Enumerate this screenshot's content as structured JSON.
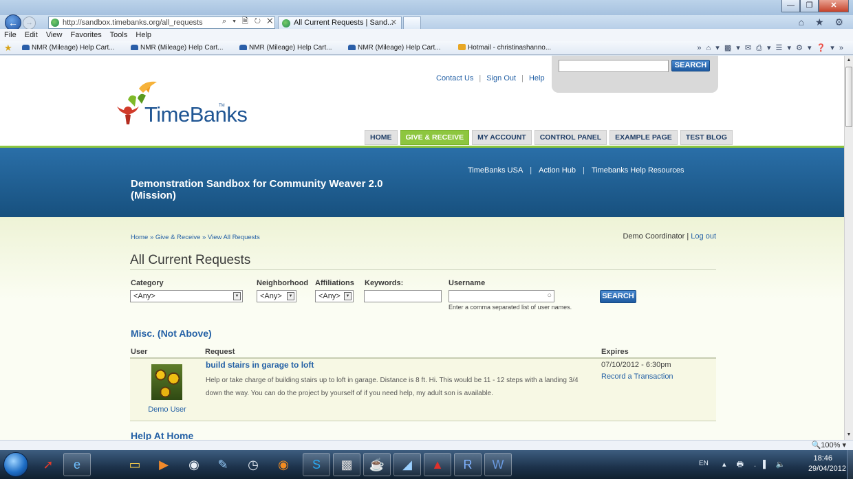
{
  "browser": {
    "address": "http://sandbox.timebanks.org/all_requests",
    "addr_tools": "⌕ ▾ 🗎 ↻ ✕",
    "tab_title": "All Current Requests | Sand...",
    "tab_close": "✕",
    "icons": "⌂ ★ ⚙",
    "menu": [
      "File",
      "Edit",
      "View",
      "Favorites",
      "Tools",
      "Help"
    ],
    "favorites": [
      "NMR (Mileage) Help Cart...",
      "NMR (Mileage) Help Cart...",
      "NMR (Mileage) Help Cart...",
      "NMR (Mileage) Help Cart...",
      "Hotmail - christinashanno..."
    ],
    "zoom": "🔍100%  ▾"
  },
  "header": {
    "search_button": "SEARCH",
    "top_links": [
      "Contact Us",
      "Sign Out",
      "Help"
    ],
    "logo_text": "TimeBanks",
    "logo_tm": "TM",
    "tabs": [
      "HOME",
      "GIVE & RECEIVE",
      "MY ACCOUNT",
      "CONTROL PANEL",
      "EXAMPLE PAGE",
      "TEST BLOG"
    ],
    "active_tab": "GIVE & RECEIVE",
    "blue_links": [
      "TimeBanks USA",
      "Action Hub",
      "Timebanks Help Resources"
    ],
    "site_title": "Demonstration Sandbox for Community Weaver 2.0 (Mission)"
  },
  "content": {
    "breadcrumb": "Home » Give & Receive » View All Requests",
    "user_name": "Demo Coordinator",
    "logout": "Log out",
    "page_title": "All Current Requests",
    "filters": {
      "category_label": "Category",
      "category_value": "<Any>",
      "neighborhood_label": "Neighborhood",
      "neighborhood_value": "<Any>",
      "affiliations_label": "Affiliations",
      "affiliations_value": "<Any>",
      "keywords_label": "Keywords:",
      "username_label": "Username",
      "username_hint": "Enter a comma separated list of user names.",
      "search_button": "SEARCH"
    },
    "section_title": "Misc. (Not Above)",
    "columns": [
      "User",
      "Request",
      "Expires"
    ],
    "rows": [
      {
        "user": "Demo User",
        "title": "build stairs in garage to loft",
        "description": "Help or take charge of building stairs up to loft in garage.  Distance is 8 ft. Hi. This would be 11 - 12 steps with a landing 3/4 down the way.  You can do the project by yourself of if you need help, my adult son is available.",
        "expires": "07/10/2012 - 6:30pm",
        "action": "Record a Transaction"
      }
    ],
    "next_section": "Help At Home"
  },
  "taskbar": {
    "lang": "EN",
    "tray": "▴ 🖶 .▐ 🔈",
    "time": "18:46",
    "date": "29/04/2012"
  }
}
